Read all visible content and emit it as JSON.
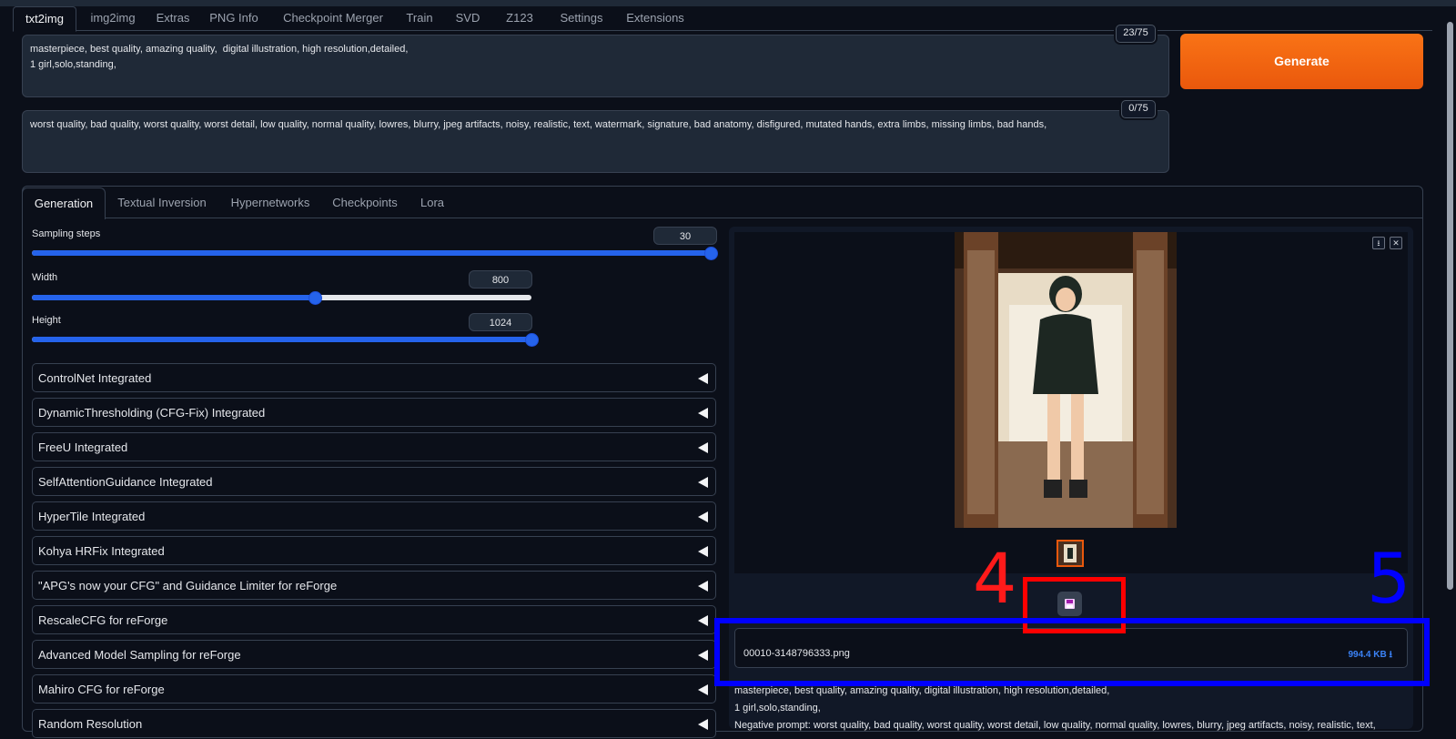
{
  "main_tabs": [
    "txt2img",
    "img2img",
    "Extras",
    "PNG Info",
    "Checkpoint Merger",
    "Train",
    "SVD",
    "Z123",
    "Settings",
    "Extensions"
  ],
  "prompt": {
    "text": "masterpiece, best quality, amazing quality,  digital illustration, high resolution,detailed,\n1 girl,solo,standing,",
    "counter": "23/75"
  },
  "negative_prompt": {
    "text": "worst quality, bad quality, worst quality, worst detail, low quality, normal quality, lowres, blurry, jpeg artifacts, noisy, realistic, text, watermark, signature, bad anatomy, disfigured, mutated hands, extra limbs, missing limbs, bad hands,",
    "counter": "0/75"
  },
  "generate_label": "Generate",
  "sub_tabs": [
    "Generation",
    "Textual Inversion",
    "Hypernetworks",
    "Checkpoints",
    "Lora"
  ],
  "sliders": {
    "steps": {
      "label": "Sampling steps",
      "value": "30",
      "fraction": 1.0
    },
    "width": {
      "label": "Width",
      "value": "800",
      "fraction": 0.567
    },
    "height": {
      "label": "Height",
      "value": "1024",
      "fraction": 1.0
    }
  },
  "accordions": [
    "ControlNet Integrated",
    "DynamicThresholding (CFG-Fix) Integrated",
    "FreeU Integrated",
    "SelfAttentionGuidance Integrated",
    "HyperTile Integrated",
    "Kohya HRFix Integrated",
    "\"APG's now your CFG\" and Guidance Limiter for reForge",
    "RescaleCFG for reForge",
    "Advanced Model Sampling for reForge",
    "Mahiro CFG for reForge",
    "Random Resolution"
  ],
  "output": {
    "file_name": "00010-3148796333.png",
    "file_size": "994.4 KB ⭳",
    "info_line1": "masterpiece, best quality, amazing quality, digital illustration, high resolution,detailed,",
    "info_line2": "1 girl,solo,standing,",
    "info_line3": "Negative prompt: worst quality, bad quality, worst quality, worst detail, low quality, normal quality, lowres, blurry, jpeg artifacts, noisy, realistic, text,"
  },
  "annotations": {
    "red_number": "4",
    "blue_number": "5"
  },
  "icons": {
    "download": "download-icon",
    "close": "close-icon",
    "save": "save-icon",
    "accordion": "triangle-left-icon"
  },
  "colors": {
    "accent": "#2563eb",
    "generate": "#f97316",
    "annotation_red": "#ff0000",
    "annotation_blue": "#0000ff"
  }
}
